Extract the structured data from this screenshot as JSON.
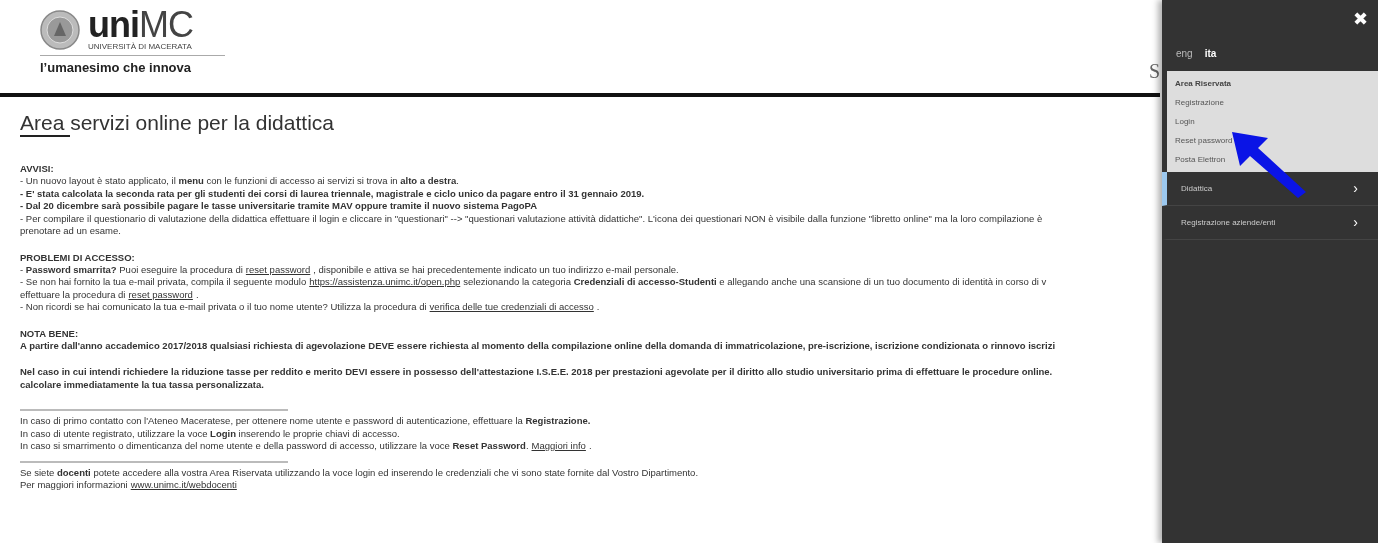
{
  "header": {
    "logo_word_bold": "uni",
    "logo_word_light": "MC",
    "logo_caption": "UNIVERSITÀ DI MACERATA",
    "tagline": "l’umanesimo che innova",
    "cut_text": "S"
  },
  "title": "Area servizi online per la didattica",
  "sections": [
    {
      "heading": "AVVISI:",
      "lines": [
        [
          {
            "kind": "text",
            "text": "- Un nuovo layout è stato applicato, il **menu** con le funzioni di accesso ai servizi si trova in **alto a destra**."
          }
        ],
        [
          {
            "kind": "strong",
            "text": "- E' stata calcolata la seconda rata per gli studenti dei corsi di laurea triennale, magistrale e ciclo unico da pagare entro il 31 gennaio 2019."
          }
        ],
        [
          {
            "kind": "strong",
            "text": "- Dal 20 dicembre sarà possibile pagare le tasse universitarie tramite MAV oppure tramite il nuovo sistema PagoPA"
          }
        ],
        [
          {
            "kind": "text",
            "text": "- Per compilare il questionario di valutazione della didattica effettuare il login e cliccare in \"questionari\" --> \"questionari valutazione attività didattiche\". L'icona dei questionari NON è visibile dalla funzione \"libretto online\" ma la loro compilazione è"
          }
        ],
        [
          {
            "kind": "text",
            "text": "prenotare ad un esame."
          }
        ]
      ]
    },
    {
      "heading": "PROBLEMI DI ACCESSO:",
      "lines": [
        [
          {
            "kind": "text",
            "text": "- **Password smarrita?** Puoi eseguire la procedura di"
          },
          {
            "kind": "link",
            "text": "reset password"
          },
          {
            "kind": "text",
            "text": ", disponibile e attiva se hai precedentemente indicato un tuo indirizzo e-mail personale."
          }
        ],
        [
          {
            "kind": "text",
            "text": "- Se non hai fornito la tua e-mail privata, compila il seguente modulo"
          },
          {
            "kind": "link",
            "text": "https://assistenza.unimc.it/open.php"
          },
          {
            "kind": "text",
            "text": "selezionando la categoria **Credenziali di accesso-Studenti** e allegando anche una scansione di un tuo documento di identità in corso di v"
          }
        ],
        [
          {
            "kind": "text",
            "text": "effettuare la procedura di"
          },
          {
            "kind": "link",
            "text": "reset password"
          },
          {
            "kind": "text",
            "text": "."
          }
        ],
        [
          {
            "kind": "text",
            "text": "- Non ricordi se hai comunicato la tua e-mail privata o il tuo nome utente? Utilizza la procedura di"
          },
          {
            "kind": "link",
            "text": "verifica delle tue credenziali di accesso"
          },
          {
            "kind": "text",
            "text": "."
          }
        ]
      ]
    },
    {
      "heading": "NOTA BENE:",
      "lines": [
        [
          {
            "kind": "strong",
            "text": "A partire dall'anno accademico 2017/2018 qualsiasi richiesta di agevolazione DEVE essere richiesta al momento della compilazione online della domanda di immatricolazione, pre-iscrizione, iscrizione condizionata o rinnovo iscrizi"
          }
        ]
      ]
    },
    {
      "lines": [
        [
          {
            "kind": "strong",
            "text": "Nel caso in cui intendi richiedere la riduzione tasse per reddito e merito DEVI essere in possesso dell'attestazione I.S.E.E. 2018 per prestazioni agevolate per il diritto allo studio universitario prima di effettuare le procedure online."
          }
        ],
        [
          {
            "kind": "strong",
            "text": "calcolare immediatamente la tua tassa personalizzata."
          }
        ]
      ]
    }
  ],
  "footer_blocks": [
    [
      [
        {
          "kind": "text",
          "text": "In caso di primo contatto con l'Ateneo Maceratese, per ottenere nome utente e password di autenticazione, effettuare la **Registrazione.**"
        }
      ],
      [
        {
          "kind": "text",
          "text": "In caso di utente registrato, utilizzare la voce **Login** inserendo le proprie chiavi di accesso."
        }
      ],
      [
        {
          "kind": "text",
          "text": "In caso si smarrimento o dimenticanza del nome utente e della password di accesso, utilizzare la voce **Reset Password**."
        },
        {
          "kind": "link",
          "text": "Maggiori info"
        },
        {
          "kind": "text",
          "text": "."
        }
      ]
    ],
    [
      [
        {
          "kind": "text",
          "text": "Se siete **docenti** potete accedere alla vostra Area Riservata utilizzando la voce login ed inserendo le credenziali che vi sono state fornite dal Vostro Dipartimento."
        }
      ],
      [
        {
          "kind": "text",
          "text": "Per maggiori informazioni"
        },
        {
          "kind": "link",
          "text": "www.unimc.it/webdocenti"
        }
      ]
    ]
  ],
  "panel": {
    "close": "✖",
    "languages": [
      {
        "label": "eng",
        "selected": false
      },
      {
        "label": "ita",
        "selected": true
      }
    ],
    "submenu": {
      "heading": "Area Riservata",
      "items": [
        "Registrazione",
        "Login",
        "Reset password",
        "Posta Elettron"
      ]
    },
    "menu": [
      {
        "label": "Didattica",
        "chevron": "›",
        "highlighted": true
      },
      {
        "label": "Registrazione aziende/enti",
        "chevron": "›",
        "highlighted": false
      }
    ]
  }
}
